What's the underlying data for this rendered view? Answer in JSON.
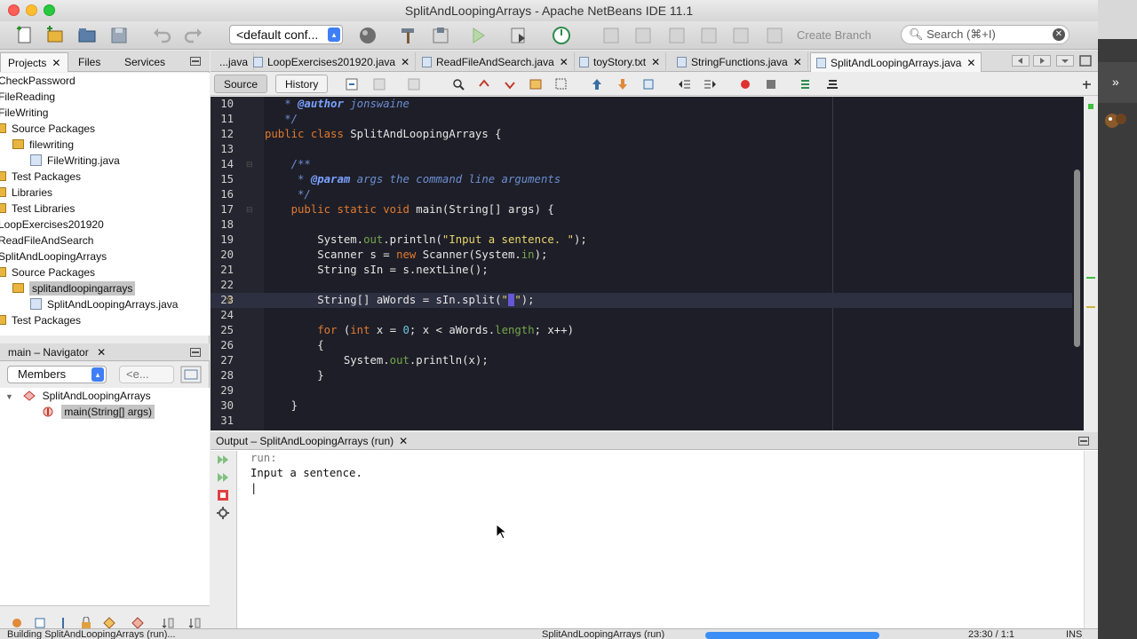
{
  "window": {
    "title": "SplitAndLoopingArrays - Apache NetBeans IDE 11.1"
  },
  "toolbar": {
    "config": "<default conf...",
    "create_branch": "Create Branch",
    "search_placeholder": "Search (⌘+I)"
  },
  "left_tabs": {
    "projects": "Projects",
    "files": "Files",
    "services": "Services"
  },
  "tree": [
    "CheckPassword",
    "FileReading",
    "FileWriting",
    "Source Packages",
    "filewriting",
    "FileWriting.java",
    "Test Packages",
    "Libraries",
    "Test Libraries",
    "LoopExercises201920",
    "ReadFileAndSearch",
    "SplitAndLoopingArrays",
    "Source Packages",
    "splitandloopingarrays",
    "SplitAndLoopingArrays.java",
    "Test Packages"
  ],
  "navigator": {
    "title": "main – Navigator",
    "members": "Members",
    "filter": "<e...",
    "class_name": "SplitAndLoopingArrays",
    "method": "main(String[] args)"
  },
  "editor_tabs": [
    "...java",
    "LoopExercises201920.java",
    "ReadFileAndSearch.java",
    "toyStory.txt",
    "StringFunctions.java",
    "SplitAndLoopingArrays.java"
  ],
  "editor_toolbar": {
    "source": "Source",
    "history": "History"
  },
  "line_numbers": [
    "10",
    "11",
    "12",
    "13",
    "14",
    "15",
    "16",
    "17",
    "18",
    "19",
    "20",
    "21",
    "22",
    "23",
    "24",
    "25",
    "26",
    "27",
    "28",
    "29",
    "30",
    "31"
  ],
  "code": {
    "l10_tag": "@author",
    "l10_text": " jonswaine",
    "l11": "*/",
    "l12_kw1": "public",
    "l12_kw2": "class",
    "l12_text": " SplitAndLoopingArrays {",
    "l14": "/**",
    "l15_tag": "@param",
    "l15_text": " args the command line arguments",
    "l16": "*/",
    "l17_kw1": "public",
    "l17_kw2": "static",
    "l17_kw3": "void",
    "l17_text": " main(String[] args) {",
    "l19_a": "System.",
    "l19_fld": "out",
    "l19_b": ".println(",
    "l19_str": "\"Input a sentence. \"",
    "l19_c": ");",
    "l20_a": "Scanner s = ",
    "l20_kw": "new",
    "l20_b": " Scanner(System.",
    "l20_fld": "in",
    "l20_c": ");",
    "l21": "String sIn = s.nextLine();",
    "l23_a": "String[] aWords = sIn.split(",
    "l23_q1": "\"",
    "l23_sel": " ",
    "l23_q2": "\"",
    "l23_b": ");",
    "l25_kw": "for",
    "l25_a": " (",
    "l25_kw2": "int",
    "l25_b": " x = ",
    "l25_n": "0",
    "l25_c": "; x < aWords.",
    "l25_fld": "length",
    "l25_d": "; x++)",
    "l26": "{",
    "l27_a": "System.",
    "l27_fld": "out",
    "l27_b": ".println(x);",
    "l28": "}",
    "l30": "}"
  },
  "output": {
    "title": "Output – SplitAndLoopingArrays (run)",
    "line1": "run:",
    "line2": "Input a sentence.",
    "line3": "|"
  },
  "status": {
    "left": "Building SplitAndLoopingArrays (run)...",
    "middle": "SplitAndLoopingArrays (run)",
    "position": "23:30 / 1:1",
    "mode": "INS"
  },
  "colors": {
    "editor_bg": "#1e1e28",
    "keyword": "#e07a2f",
    "comment": "#6b8fd0",
    "string": "#e6d66b",
    "field": "#74a84c"
  }
}
